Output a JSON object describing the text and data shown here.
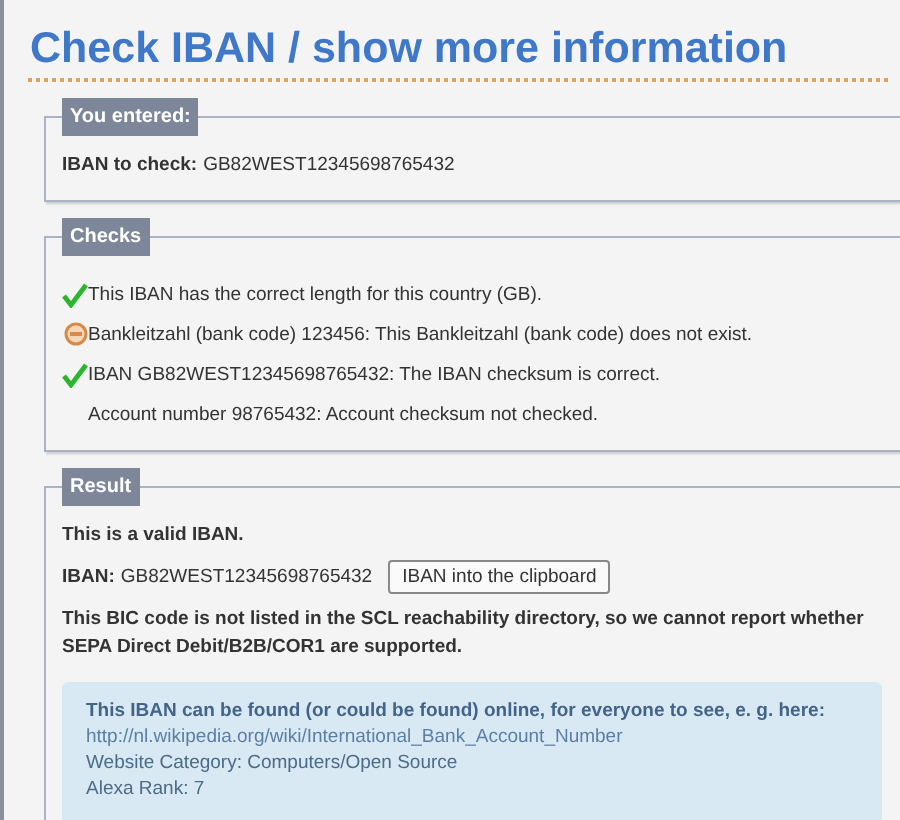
{
  "title": "Check IBAN / show more information",
  "entered": {
    "legend": "You entered:",
    "label": "IBAN to check:",
    "value": "GB82WEST12345698765432"
  },
  "checks": {
    "legend": "Checks",
    "items": [
      {
        "kind": "ok",
        "text": "This IBAN has the correct length for this country (GB)."
      },
      {
        "kind": "error",
        "text": "Bankleitzahl (bank code) 123456: This Bankleitzahl (bank code) does not exist."
      },
      {
        "kind": "ok",
        "text": "IBAN GB82WEST12345698765432: The IBAN checksum is correct."
      },
      {
        "kind": "none",
        "text": "Account number 98765432: Account checksum not checked."
      }
    ]
  },
  "result": {
    "legend": "Result",
    "verdict": "This is a valid IBAN.",
    "iban_label": "IBAN:",
    "iban": "GB82WEST12345698765432",
    "copy_button": "IBAN into the clipboard",
    "bic_note": "This BIC code is not listed in the SCL reachability directory, so we cannot report whether SEPA Direct Debit/B2B/COR1 are supported.",
    "info": {
      "heading": "This IBAN can be found (or could be found) online, for everyone to see, e. g. here:",
      "link": "http://nl.wikipedia.org/wiki/International_Bank_Account_Number",
      "category": "Website Category: Computers/Open Source",
      "rank": "Alexa Rank: 7"
    }
  }
}
